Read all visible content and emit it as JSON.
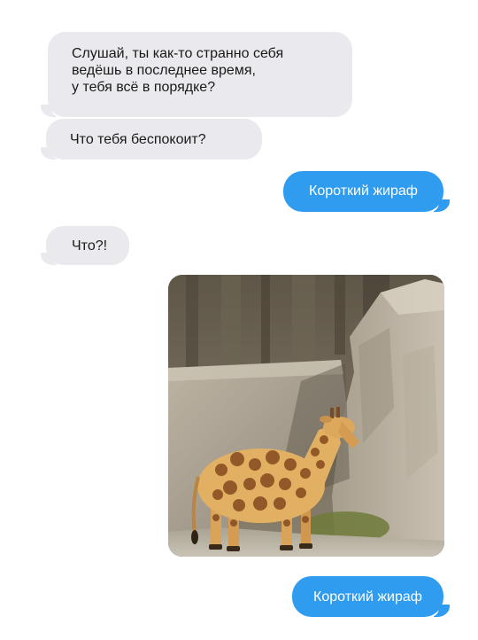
{
  "messages": [
    {
      "id": "msg1",
      "side": "incoming",
      "lines": [
        "Слушай, ты как-то странно себя",
        "ведёшь в последнее время,",
        "у тебя всё в порядке?"
      ]
    },
    {
      "id": "msg2",
      "side": "incoming",
      "text": "Что тебя беспокоит?"
    },
    {
      "id": "msg3",
      "side": "outgoing",
      "text": "Короткий жираф"
    },
    {
      "id": "msg4",
      "side": "incoming",
      "text": "Что?!"
    },
    {
      "id": "msg5",
      "side": "outgoing",
      "text": "Короткий жираф"
    }
  ],
  "photo": {
    "icon": "short-giraffe-photo"
  },
  "colors": {
    "incoming_bubble": "#e9e9ee",
    "outgoing_bubble": "#2f9cf0",
    "incoming_text": "#1a1a1a",
    "outgoing_text": "#ffffff",
    "background": "#ffffff"
  }
}
